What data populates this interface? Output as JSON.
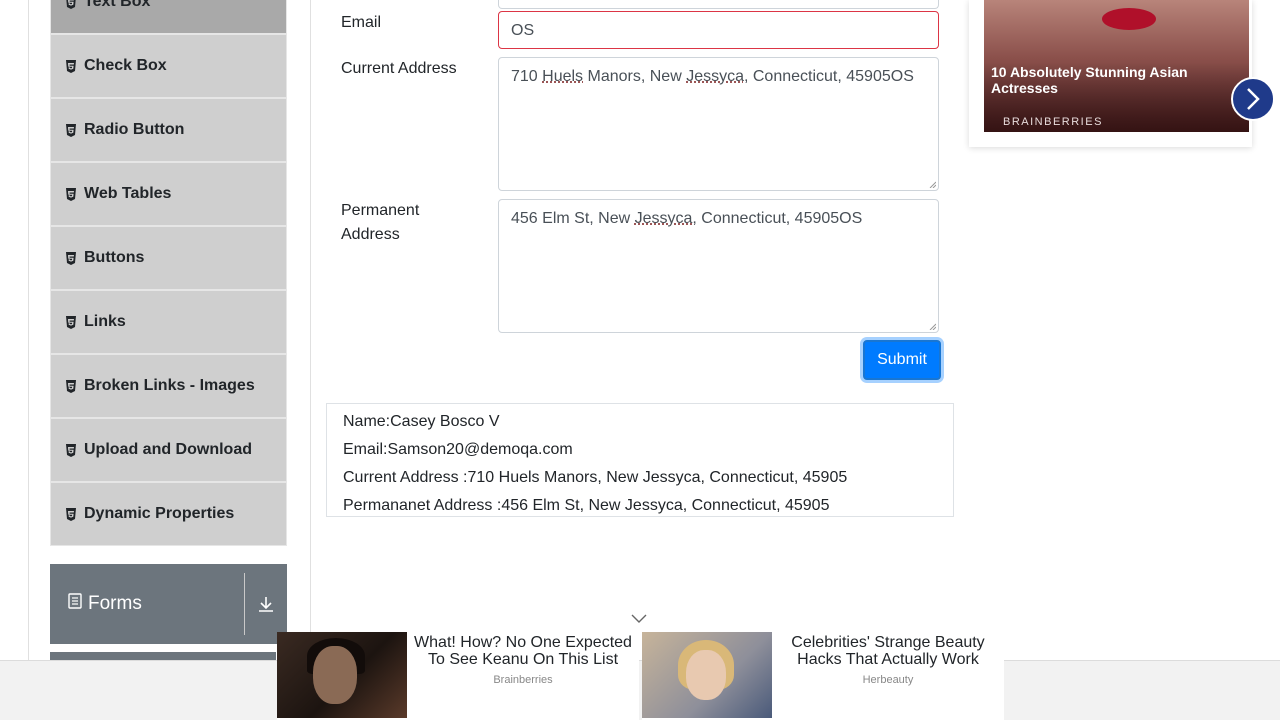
{
  "sidebar": {
    "items": [
      {
        "label": "Text Box"
      },
      {
        "label": "Check Box"
      },
      {
        "label": "Radio Button"
      },
      {
        "label": "Web Tables"
      },
      {
        "label": "Buttons"
      },
      {
        "label": "Links"
      },
      {
        "label": "Broken Links - Images"
      },
      {
        "label": "Upload and Download"
      },
      {
        "label": "Dynamic Properties"
      }
    ],
    "group": {
      "label": "Forms"
    }
  },
  "form": {
    "email_label": "Email",
    "email_value": "OS",
    "current_address_label": "Current Address",
    "current_address_parts": [
      "710 ",
      "Huels",
      " Manors, New ",
      "Jessyca",
      ", Connecticut, 45905OS"
    ],
    "permanent_address_label_1": "Permanent",
    "permanent_address_label_2": "Address",
    "permanent_address_parts": [
      "456 Elm St, New ",
      "Jessyca",
      ", Connecticut, 45905OS"
    ],
    "submit_label": "Submit"
  },
  "output": {
    "name": "Name:Casey Bosco V",
    "email": "Email:Samson20@demoqa.com",
    "current_address": "Current Address :710 Huels Manors, New Jessyca, Connecticut, 45905",
    "permanent_address": "Permananet Address :456 Elm St, New Jessyca, Connecticut, 45905"
  },
  "ad_side": {
    "title": "10 Absolutely Stunning Asian Actresses",
    "source": "BRAINBERRIES"
  },
  "ads_bottom": [
    {
      "headline": "What! How? No One Expected To See Keanu On This List",
      "source": "Brainberries"
    },
    {
      "headline": "Celebrities' Strange Beauty Hacks That Actually Work",
      "source": "Herbeauty"
    }
  ],
  "colors": {
    "accent": "#007bff",
    "error_border": "#dc3545",
    "sidebar_item": "#cfcfcf",
    "group_header": "#6c757d"
  }
}
